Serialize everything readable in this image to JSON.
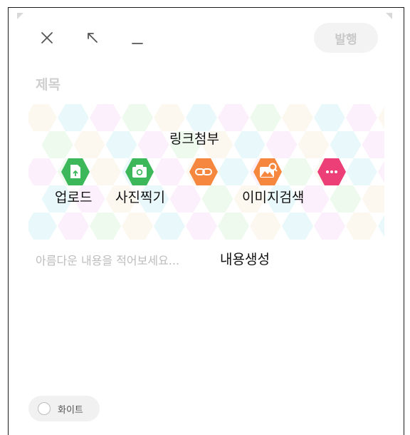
{
  "toolbar": {
    "close_icon": "close-icon",
    "shrink_icon": "arrow-up-left-icon",
    "minimize_icon": "minimize-icon",
    "publish_label": "발행"
  },
  "editor": {
    "title_placeholder": "제목",
    "body_placeholder": "아름다운 내용을 적어보세요...",
    "generate_label": "내용생성"
  },
  "tools": [
    {
      "icon": "file-upload-icon",
      "color": "#3cb85a",
      "label": "업로드"
    },
    {
      "icon": "camera-icon",
      "color": "#3cb85a",
      "label": "사진찍기"
    },
    {
      "icon": "link-icon",
      "color": "#f5883e",
      "label": "링크첨부"
    },
    {
      "icon": "image-search-icon",
      "color": "#f5883e",
      "label": "이미지검색"
    },
    {
      "icon": "more-icon",
      "color": "#ec3f78",
      "label": ""
    }
  ],
  "footer": {
    "theme_label": "화이트"
  }
}
